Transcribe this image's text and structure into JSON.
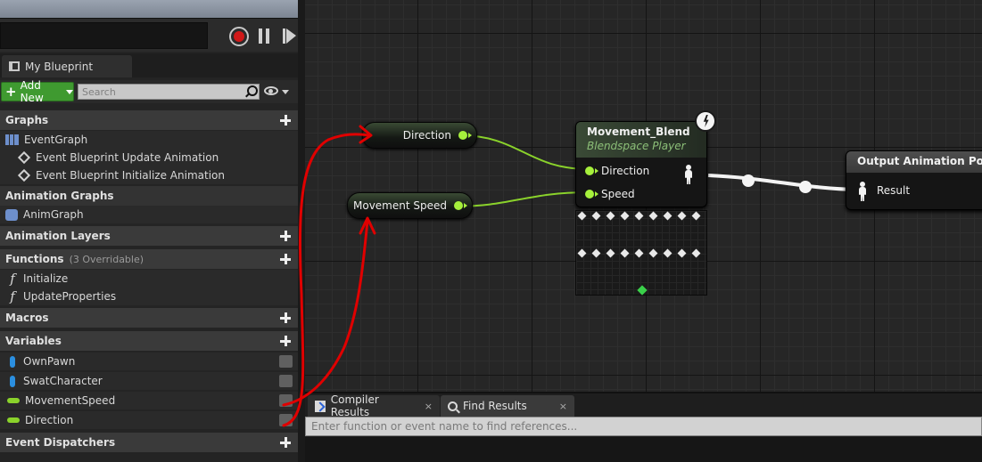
{
  "left_panel": {
    "tab_label": "My Blueprint",
    "add_new_label": "Add New",
    "search_placeholder": "Search",
    "categories": {
      "graphs": "Graphs",
      "animation_graphs": "Animation Graphs",
      "animation_layers": "Animation Layers",
      "functions": "Functions",
      "functions_sub": "(3 Overridable)",
      "macros": "Macros",
      "variables": "Variables",
      "event_dispatchers": "Event Dispatchers"
    },
    "graph_items": [
      "EventGraph",
      "Event Blueprint Update Animation",
      "Event Blueprint Initialize Animation"
    ],
    "anim_graph_items": [
      "AnimGraph"
    ],
    "function_items": [
      "Initialize",
      "UpdateProperties"
    ],
    "variables": [
      "OwnPawn",
      "SwatCharacter",
      "MovementSpeed",
      "Direction"
    ]
  },
  "graph": {
    "direction_node": "Direction",
    "movement_speed_node": "Movement Speed",
    "blend_node": {
      "title": "Movement_Blend",
      "subtitle": "Blendspace Player",
      "inputs": [
        "Direction",
        "Speed"
      ]
    },
    "output_node": {
      "title": "Output Animation Pose",
      "pin": "Result"
    }
  },
  "bottom_panel": {
    "tabs": [
      "Compiler Results",
      "Find Results"
    ],
    "close_glyph": "×",
    "find_placeholder": "Enter function or event name to find references..."
  },
  "colors": {
    "float_pin": "#a6f03c",
    "object_pin": "#2b8fe0",
    "add_new": "#3f9a30",
    "annotation": "#e00000"
  }
}
